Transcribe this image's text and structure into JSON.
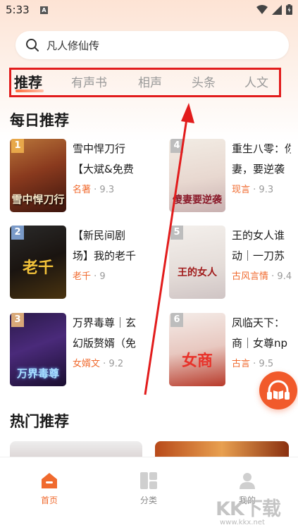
{
  "status_bar": {
    "time": "5:33",
    "badge": "A"
  },
  "search": {
    "query": "凡人修仙传"
  },
  "tabs": [
    {
      "label": "推荐",
      "active": true
    },
    {
      "label": "有声书",
      "active": false
    },
    {
      "label": "相声",
      "active": false
    },
    {
      "label": "头条",
      "active": false
    },
    {
      "label": "人文",
      "active": false
    }
  ],
  "daily": {
    "title": "每日推荐",
    "books": [
      {
        "rank": "1",
        "title_lines": [
          "雪中悍刀行",
          "【大斌&免费"
        ],
        "genre": "名著",
        "score": "9.3",
        "cover_text": "雪中悍刀行"
      },
      {
        "rank": "2",
        "title_lines": [
          "【新民间剧",
          "场】我的老千"
        ],
        "genre": "老千",
        "score": "9",
        "cover_text": "老千"
      },
      {
        "rank": "3",
        "title_lines": [
          "万界毒尊｜玄",
          "幻版赘婿（免"
        ],
        "genre": "女婿文",
        "score": "9.2",
        "cover_text": "万界毒尊"
      },
      {
        "rank": "4",
        "title_lines": [
          "重生八零：你",
          "妻，要逆袭"
        ],
        "genre": "现言",
        "score": "9.3",
        "cover_text": "傻妻要逆袭"
      },
      {
        "rank": "5",
        "title_lines": [
          "王的女人谁",
          "动｜一刀苏"
        ],
        "genre": "古风言情",
        "score": "9.4",
        "cover_text": "王的女人"
      },
      {
        "rank": "6",
        "title_lines": [
          "凤临天下：",
          "商｜女尊np"
        ],
        "genre": "古言",
        "score": "9.5",
        "cover_text": "女商"
      }
    ]
  },
  "hot": {
    "title": "热门推荐"
  },
  "nav": [
    {
      "label": "首页",
      "icon": "home-icon",
      "active": true
    },
    {
      "label": "分类",
      "icon": "category-icon",
      "active": false
    },
    {
      "label": "我的",
      "icon": "profile-icon",
      "active": false
    }
  ],
  "colors": {
    "accent": "#f06a2e",
    "annotation": "#e21c1c",
    "fab": "#f15a2b"
  },
  "watermark": {
    "main": "KK下载",
    "sub": "www.kkx.net"
  }
}
